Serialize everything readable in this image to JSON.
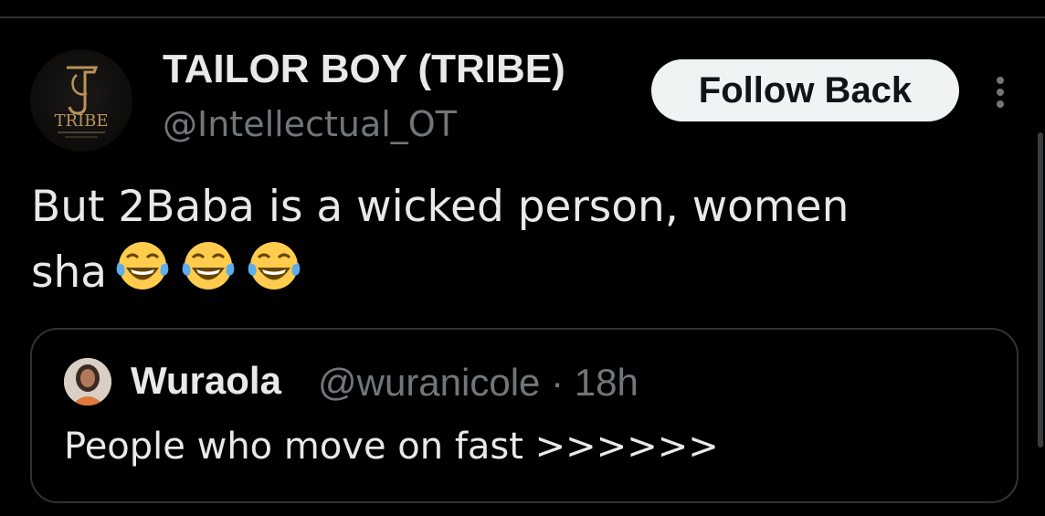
{
  "post": {
    "author_display_name": "TAILOR BOY (TRIBE)",
    "author_handle": "@Intellectual_OT",
    "avatar_logo_text": "TRIBE",
    "follow_button_label": "Follow Back",
    "text_line_1": "But 2Baba is a wicked person, women",
    "text_line_2": "sha",
    "emojis": [
      "face-with-tears-of-joy-emoji",
      "face-with-tears-of-joy-emoji",
      "face-with-tears-of-joy-emoji"
    ]
  },
  "quoted_post": {
    "author_display_name": "Wuraola",
    "author_handle": "@wuranicole",
    "separator": "·",
    "timestamp": "18h",
    "text": "People who move on fast >>>>>>"
  },
  "icons": {
    "more": "more-vertical-icon"
  },
  "colors": {
    "background": "#000000",
    "primary_text": "#e7e9ea",
    "secondary_text": "#71767b",
    "border": "#2f3336",
    "button_bg": "#eff3f4",
    "button_text": "#0f1419",
    "logo_gold": "#b8945a",
    "emoji_yellow": "#ffcc4d",
    "emoji_tear": "#5dadec"
  }
}
